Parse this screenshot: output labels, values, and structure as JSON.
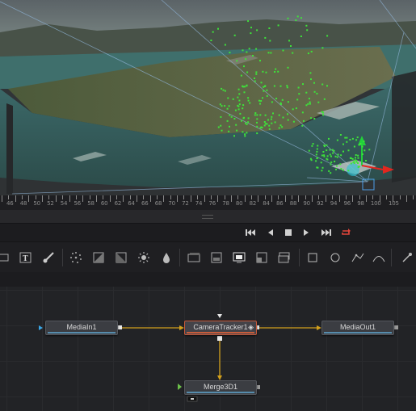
{
  "viewer": {
    "ruler_labels": [
      "46",
      "48",
      "50",
      "52",
      "54",
      "56",
      "58",
      "60",
      "62",
      "64",
      "66",
      "68",
      "70",
      "72",
      "74",
      "76",
      "78",
      "80",
      "82",
      "84",
      "86",
      "88",
      "90",
      "92",
      "94",
      "96",
      "98",
      "100",
      "105"
    ]
  },
  "transport": {
    "buttons": [
      "go-to-start",
      "step-back",
      "stop",
      "play",
      "go-to-end",
      "loop"
    ],
    "loop_color": "#e2453a"
  },
  "toolbar": {
    "tools": [
      "merge-3d",
      "text",
      "paint",
      "particles",
      "brightness-contrast",
      "color-corrector",
      "glow",
      "blur",
      "matte",
      "background",
      "merge",
      "color",
      "rectangle",
      "ellipse",
      "polygon",
      "bspline",
      "transform"
    ]
  },
  "nodes": {
    "mediain": {
      "label": "MediaIn1"
    },
    "cameratracker": {
      "label": "CameraTracker1"
    },
    "mediaout": {
      "label": "MediaOut1"
    },
    "merge3d": {
      "label": "Merge3D1"
    }
  },
  "colors": {
    "wire": "#d2a01c",
    "tracker_points": "#3ee33a",
    "selected_node_border": "#c85a3a"
  }
}
